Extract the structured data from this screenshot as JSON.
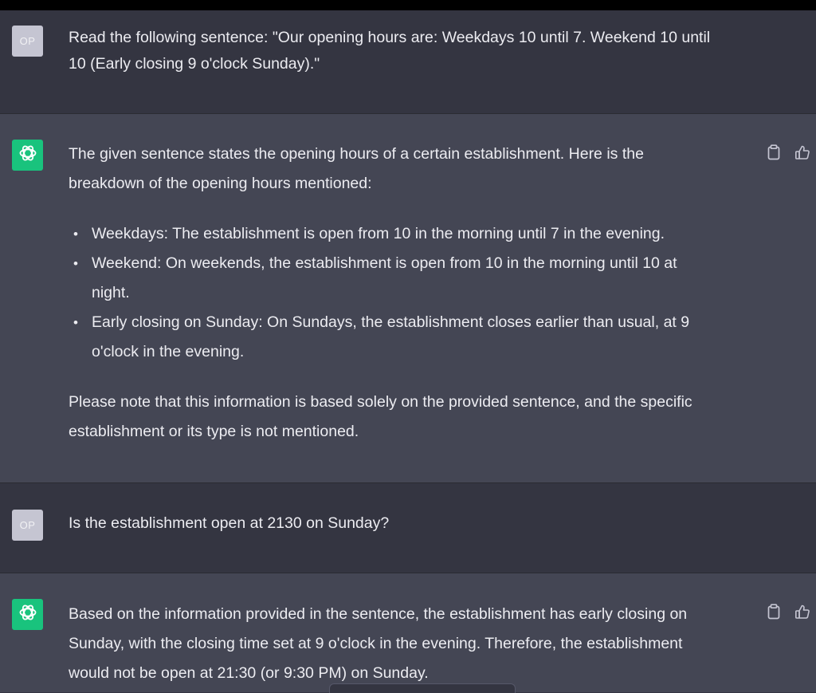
{
  "messages": [
    {
      "role": "user",
      "avatar_label": "OP",
      "lines": [
        "Read the following sentence: \"Our opening hours are: Weekdays 10 until 7. Weekend 10 until",
        "10 (Early closing 9 o'clock Sunday).\""
      ]
    },
    {
      "role": "assistant",
      "avatar_icon": "openai-logo-icon",
      "intro": [
        "The given sentence states the opening hours of a certain establishment. Here is the",
        "breakdown of the opening hours mentioned:"
      ],
      "bullets": [
        [
          "Weekdays: The establishment is open from 10 in the morning until 7 in the evening."
        ],
        [
          "Weekend: On weekends, the establishment is open from 10 in the morning until 10 at",
          "night."
        ],
        [
          "Early closing on Sunday: On Sundays, the establishment closes earlier than usual, at 9",
          "o'clock in the evening."
        ]
      ],
      "outro": [
        "Please note that this information is based solely on the provided sentence, and the specific",
        "establishment or its type is not mentioned."
      ],
      "actions": [
        "clipboard-icon",
        "thumbs-up-icon"
      ]
    },
    {
      "role": "user",
      "avatar_label": "OP",
      "lines": [
        "Is the establishment open at 2130 on Sunday?"
      ]
    },
    {
      "role": "assistant",
      "avatar_icon": "openai-logo-icon",
      "lines": [
        "Based on the information provided in the sentence, the establishment has early closing on",
        "Sunday, with the closing time set at 9 o'clock in the evening. Therefore, the establishment",
        "would not be open at 21:30 (or 9:30 PM) on Sunday."
      ],
      "actions": [
        "clipboard-icon",
        "thumbs-up-icon"
      ]
    }
  ],
  "colors": {
    "user_bg": "#343541",
    "assistant_bg": "#444654",
    "bot_avatar": "#19c37d",
    "user_avatar": "#c5c5d2",
    "text": "#ececf1"
  }
}
